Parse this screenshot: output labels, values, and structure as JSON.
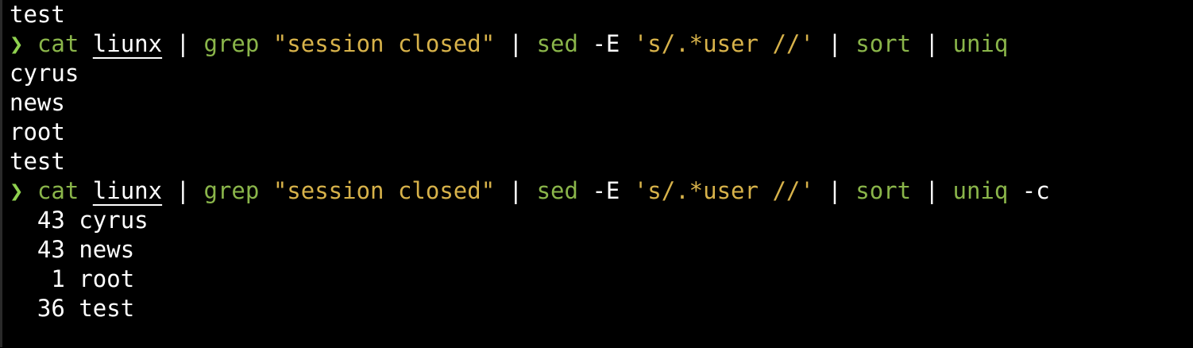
{
  "colors": {
    "background": "#000000",
    "prompt": "#8fd14f",
    "command": "#8ab54a",
    "string": "#d7b24a",
    "text": "#ffffff"
  },
  "terminal": {
    "line1": "test",
    "cmd1": {
      "prompt": "❯",
      "cat": "cat",
      "file": "liunx",
      "pipe1": "|",
      "grep": "grep",
      "grep_arg": "\"session closed\"",
      "pipe2": "|",
      "sed": "sed",
      "sed_flag": "-E",
      "sed_arg": "'s/.*user //'",
      "pipe3": "|",
      "sort": "sort",
      "pipe4": "|",
      "uniq": "uniq"
    },
    "output1": [
      "cyrus",
      "news",
      "root",
      "test"
    ],
    "cmd2": {
      "prompt": "❯",
      "cat": "cat",
      "file": "liunx",
      "pipe1": "|",
      "grep": "grep",
      "grep_arg": "\"session closed\"",
      "pipe2": "|",
      "sed": "sed",
      "sed_flag": "-E",
      "sed_arg": "'s/.*user //'",
      "pipe3": "|",
      "sort": "sort",
      "pipe4": "|",
      "uniq": "uniq",
      "uniq_flag": "-c"
    },
    "output2": [
      {
        "count": "43",
        "name": "cyrus"
      },
      {
        "count": "43",
        "name": "news"
      },
      {
        "count": "1",
        "name": "root"
      },
      {
        "count": "36",
        "name": "test"
      }
    ]
  }
}
